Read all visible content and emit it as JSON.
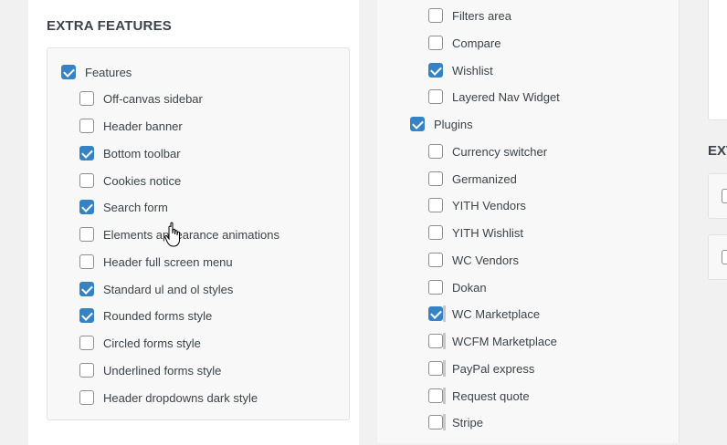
{
  "left": {
    "title": "EXTRA FEATURES",
    "parent": {
      "label": "Features",
      "checked": true
    },
    "items": [
      {
        "label": "Off-canvas sidebar",
        "checked": false
      },
      {
        "label": "Header banner",
        "checked": false
      },
      {
        "label": "Bottom toolbar",
        "checked": true
      },
      {
        "label": "Cookies notice",
        "checked": false
      },
      {
        "label": "Search form",
        "checked": true
      },
      {
        "label": "Elements appearance animations",
        "checked": false
      },
      {
        "label": "Header full screen menu",
        "checked": false
      },
      {
        "label": "Standard ul and ol styles",
        "checked": true
      },
      {
        "label": "Rounded forms style",
        "checked": true
      },
      {
        "label": "Circled forms style",
        "checked": false
      },
      {
        "label": "Underlined forms style",
        "checked": false
      },
      {
        "label": "Header dropdowns dark style",
        "checked": false
      }
    ]
  },
  "middle": {
    "top_items": [
      {
        "label": "Filters area",
        "checked": false
      },
      {
        "label": "Compare",
        "checked": false
      },
      {
        "label": "Wishlist",
        "checked": true
      },
      {
        "label": "Layered Nav Widget",
        "checked": false
      }
    ],
    "plugins": {
      "label": "Plugins",
      "checked": true
    },
    "plugin_items": [
      {
        "label": "Currency switcher",
        "checked": false
      },
      {
        "label": "Germanized",
        "checked": false
      },
      {
        "label": "YITH Vendors",
        "checked": false
      },
      {
        "label": "YITH Wishlist",
        "checked": false
      },
      {
        "label": "WC Vendors",
        "checked": false
      },
      {
        "label": "Dokan",
        "checked": false
      },
      {
        "label": "WC Marketplace",
        "checked": true
      },
      {
        "label": "WCFM Marketplace",
        "checked": false
      },
      {
        "label": "PayPal express",
        "checked": false
      },
      {
        "label": "Request quote",
        "checked": false
      },
      {
        "label": "Stripe",
        "checked": false
      }
    ]
  },
  "right": {
    "title_partial": "EXT"
  },
  "colors": {
    "accent": "#3582c4",
    "background": "#f1f1f1"
  }
}
